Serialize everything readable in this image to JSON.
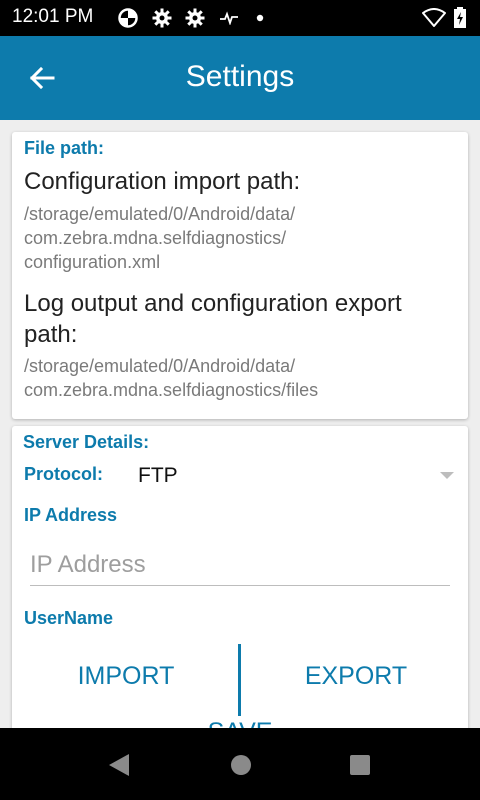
{
  "status_bar": {
    "time": "12:01 PM",
    "icons": [
      "data-saver-icon",
      "gear-icon",
      "gear-icon",
      "activity-icon",
      "dot-icon",
      "wifi-icon",
      "battery-charging-icon"
    ]
  },
  "app_bar": {
    "title": "Settings",
    "back_icon": "arrow-left-icon",
    "color": "#0d7bac"
  },
  "file_path": {
    "section_label": "File path:",
    "config_import_label": "Configuration import path:",
    "config_import_path_line1": "/storage/emulated/0/Android/data/",
    "config_import_path_line2": "com.zebra.mdna.selfdiagnostics/",
    "config_import_path_line3": "configuration.xml",
    "log_export_label_line1": "Log output and configuration export",
    "log_export_label_line2": "path:",
    "log_export_path_line1": "/storage/emulated/0/Android/data/",
    "log_export_path_line2": "com.zebra.mdna.selfdiagnostics/files"
  },
  "server_details": {
    "section_label": "Server Details:",
    "protocol_label": "Protocol:",
    "protocol_value": "FTP",
    "ip_label": "IP Address",
    "ip_placeholder": "IP Address",
    "username_label": "UserName"
  },
  "actions": {
    "import_label": "IMPORT",
    "export_label": "EXPORT",
    "save_label": "SAVE"
  },
  "nav_bar": {
    "icons": [
      "back-triangle-icon",
      "home-circle-icon",
      "recents-square-icon"
    ]
  }
}
